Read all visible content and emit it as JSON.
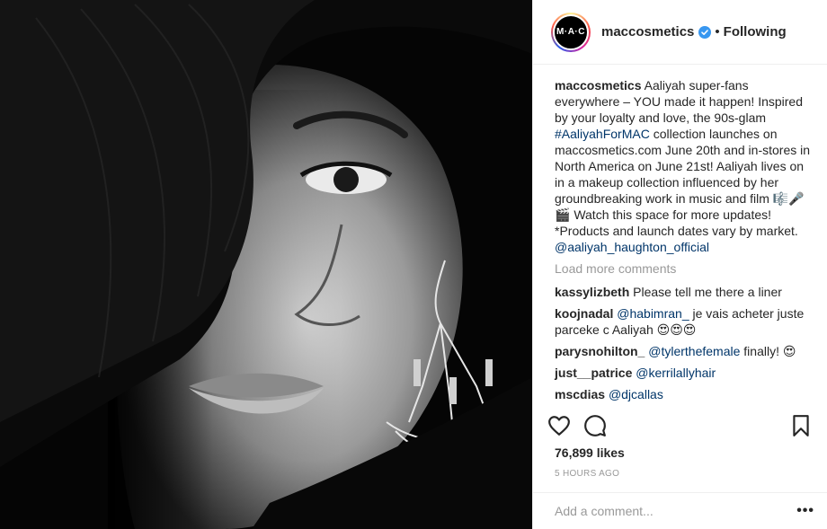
{
  "post": {
    "username": "maccosmetics",
    "avatar_text": "M·A·C",
    "follow_label": "Following",
    "separator": "•",
    "caption": {
      "username": "maccosmetics",
      "text_part1": " Aaliyah super-fans everywhere – YOU made it happen! Inspired by your loyalty and love, the 90s-glam ",
      "hashtag": "#AaliyahForMAC",
      "text_part2": " collection launches on maccosmetics.com June 20th and in-stores in North America on June 21st! Aaliyah lives on in a makeup collection influenced by her groundbreaking work in music and film 🎼🎤🎬 Watch this space for more updates! *Products and launch dates vary by market. ",
      "mention": "@aaliyah_haughton_official"
    },
    "load_more_label": "Load more comments",
    "comments": [
      {
        "user": "kassylizbeth",
        "mention": "",
        "text": "Please tell me there a liner"
      },
      {
        "user": "koojnadal",
        "mention": "@habimran_",
        "text": " je vais acheter juste parceke c Aaliyah 😍😍😍"
      },
      {
        "user": "parysnohilton_",
        "mention": "@tylerthefemale",
        "text": " finally! 😍"
      },
      {
        "user": "just__patrice",
        "mention": "@kerrilallyhair",
        "text": ""
      },
      {
        "user": "mscdias",
        "mention": "@djcallas",
        "text": ""
      }
    ],
    "likes": "76,899 likes",
    "timestamp": "5 HOURS AGO",
    "add_comment_placeholder": "Add a comment...",
    "more_options": "•••"
  },
  "icons": {
    "like": "heart-icon",
    "comment": "comment-bubble-icon",
    "save": "bookmark-icon",
    "verified": "verified-badge-icon"
  },
  "colors": {
    "link": "#003569",
    "muted": "#999999",
    "verified": "#3897f0"
  }
}
